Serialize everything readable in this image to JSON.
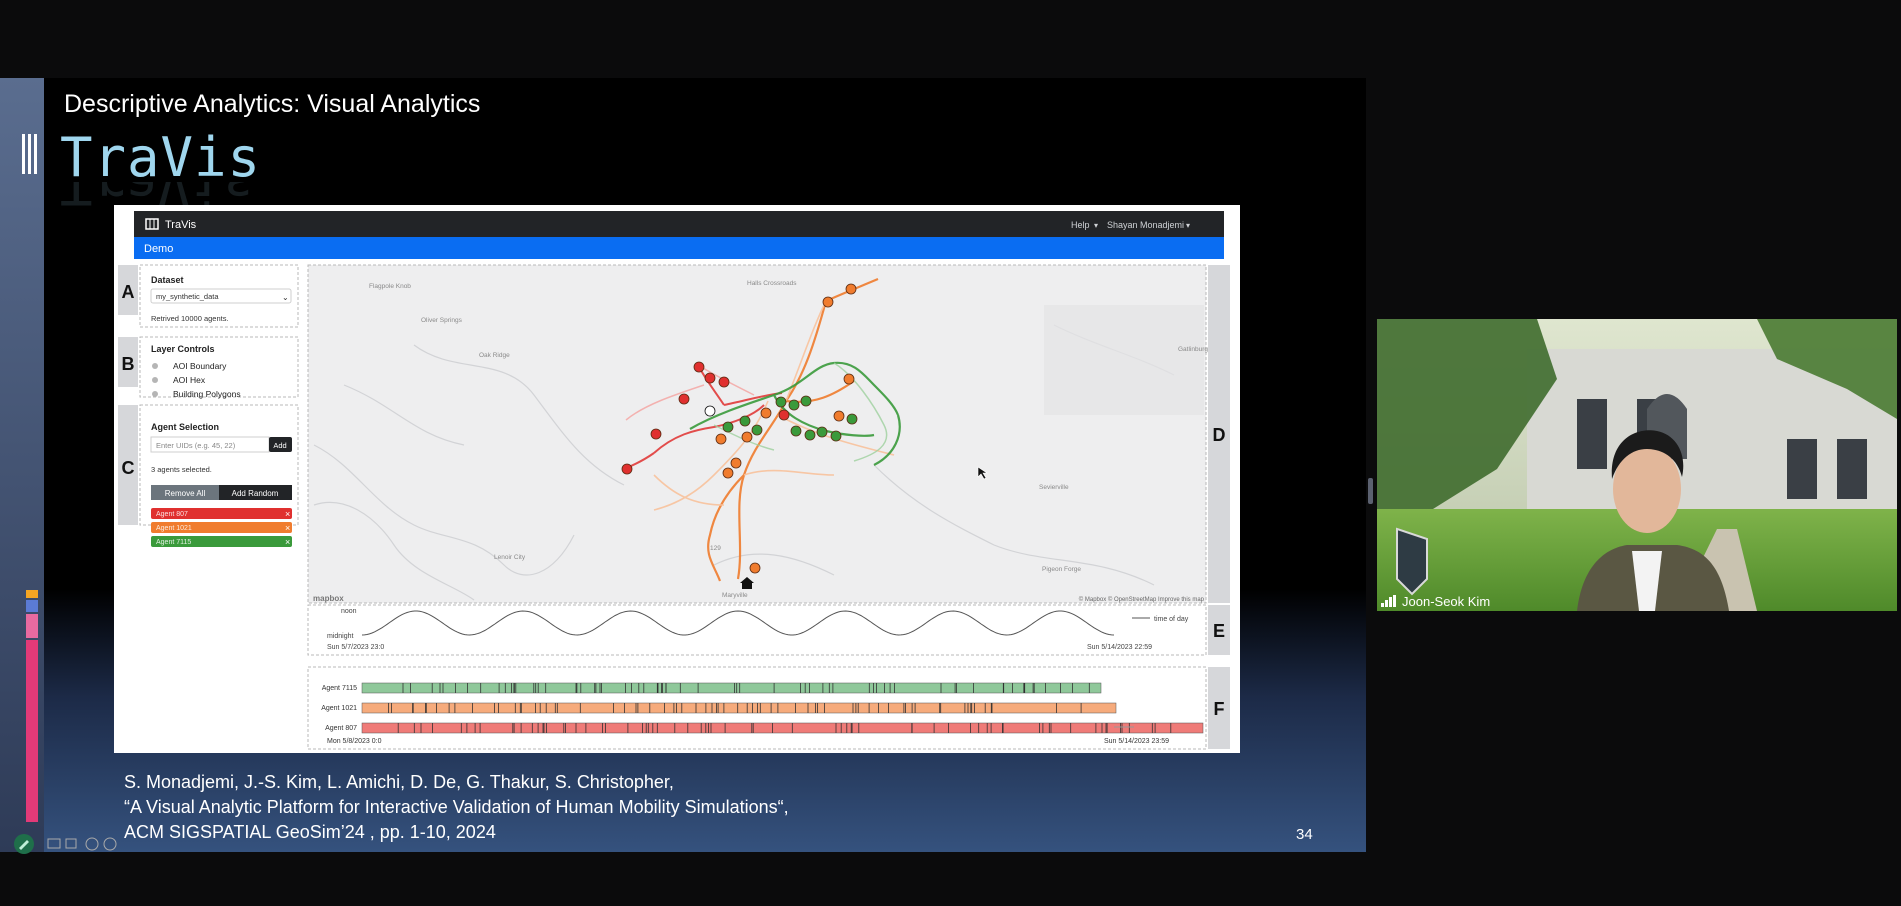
{
  "slide": {
    "title": "Descriptive Analytics: Visual Analytics",
    "app_name": "TraVis",
    "citation_lines": [
      "S. Monadjemi, J.-S. Kim, L. Amichi, D. De, G. Thakur, S. Christopher,",
      "“A Visual Analytic Platform for Interactive Validation of Human Mobility Simulations“,",
      "ACM SIGSPATIAL GeoSim’24 , pp. 1-10, 2024"
    ],
    "page_number": "34"
  },
  "travis": {
    "brand": "TraVis",
    "nav": {
      "help": "Help",
      "user": "Shayan Monadjemi"
    },
    "tab": "Demo",
    "panels": {
      "A": {
        "letter": "A",
        "heading": "Dataset",
        "select_value": "my_synthetic_data",
        "status": "Retrived 10000 agents."
      },
      "B": {
        "letter": "B",
        "heading": "Layer Controls",
        "layers": [
          "AOI Boundary",
          "AOI Hex",
          "Building Polygons"
        ]
      },
      "C": {
        "letter": "C",
        "heading": "Agent Selection",
        "input_placeholder": "Enter UIDs (e.g. 45, 22)",
        "add_label": "Add",
        "status": "3 agents selected.",
        "remove_all_label": "Remove All",
        "add_random_label": "Add Random",
        "agents": [
          {
            "label": "Agent 807",
            "color": "#e0302f"
          },
          {
            "label": "Agent 1021",
            "color": "#f07c2e"
          },
          {
            "label": "Agent 7115",
            "color": "#3a9a3b"
          }
        ],
        "remove_glyph": "×"
      },
      "D": {
        "letter": "D",
        "place_labels": [
          "Flagpole Knob",
          "Oliver Springs",
          "Oak Ridge",
          "Halls Crossroads",
          "Lenoir City",
          "Maryville",
          "Sevierville",
          "Pigeon Forge",
          "Gatlinburg"
        ],
        "road_shield": "129",
        "attribution": "© Mapbox © OpenStreetMap Improve this map",
        "logo": "mapbox"
      },
      "E": {
        "letter": "E",
        "top_label": "noon",
        "bottom_label": "midnight",
        "start": "Sun 5/7/2023 23:0",
        "end": "Sun 5/14/2023 22:59",
        "legend": "time of day"
      },
      "F": {
        "letter": "F",
        "rows": [
          {
            "label": "Agent 7115",
            "color": "#8fc89a"
          },
          {
            "label": "Agent 1021",
            "color": "#f6ab7c"
          },
          {
            "label": "Agent 807",
            "color": "#ef7b78"
          }
        ],
        "start": "Mon 5/8/2023 0:0",
        "end": "Sun 5/14/2023 23:59"
      }
    }
  },
  "webcam": {
    "participant_name": "Joon-Seok Kim"
  },
  "colors": {
    "accent_blue": "#0a6df2",
    "nav_dark": "#222427",
    "title_cyan": "#9fd6ee",
    "agent_red": "#e0302f",
    "agent_orange": "#f07c2e",
    "agent_green": "#3a9a3b"
  }
}
